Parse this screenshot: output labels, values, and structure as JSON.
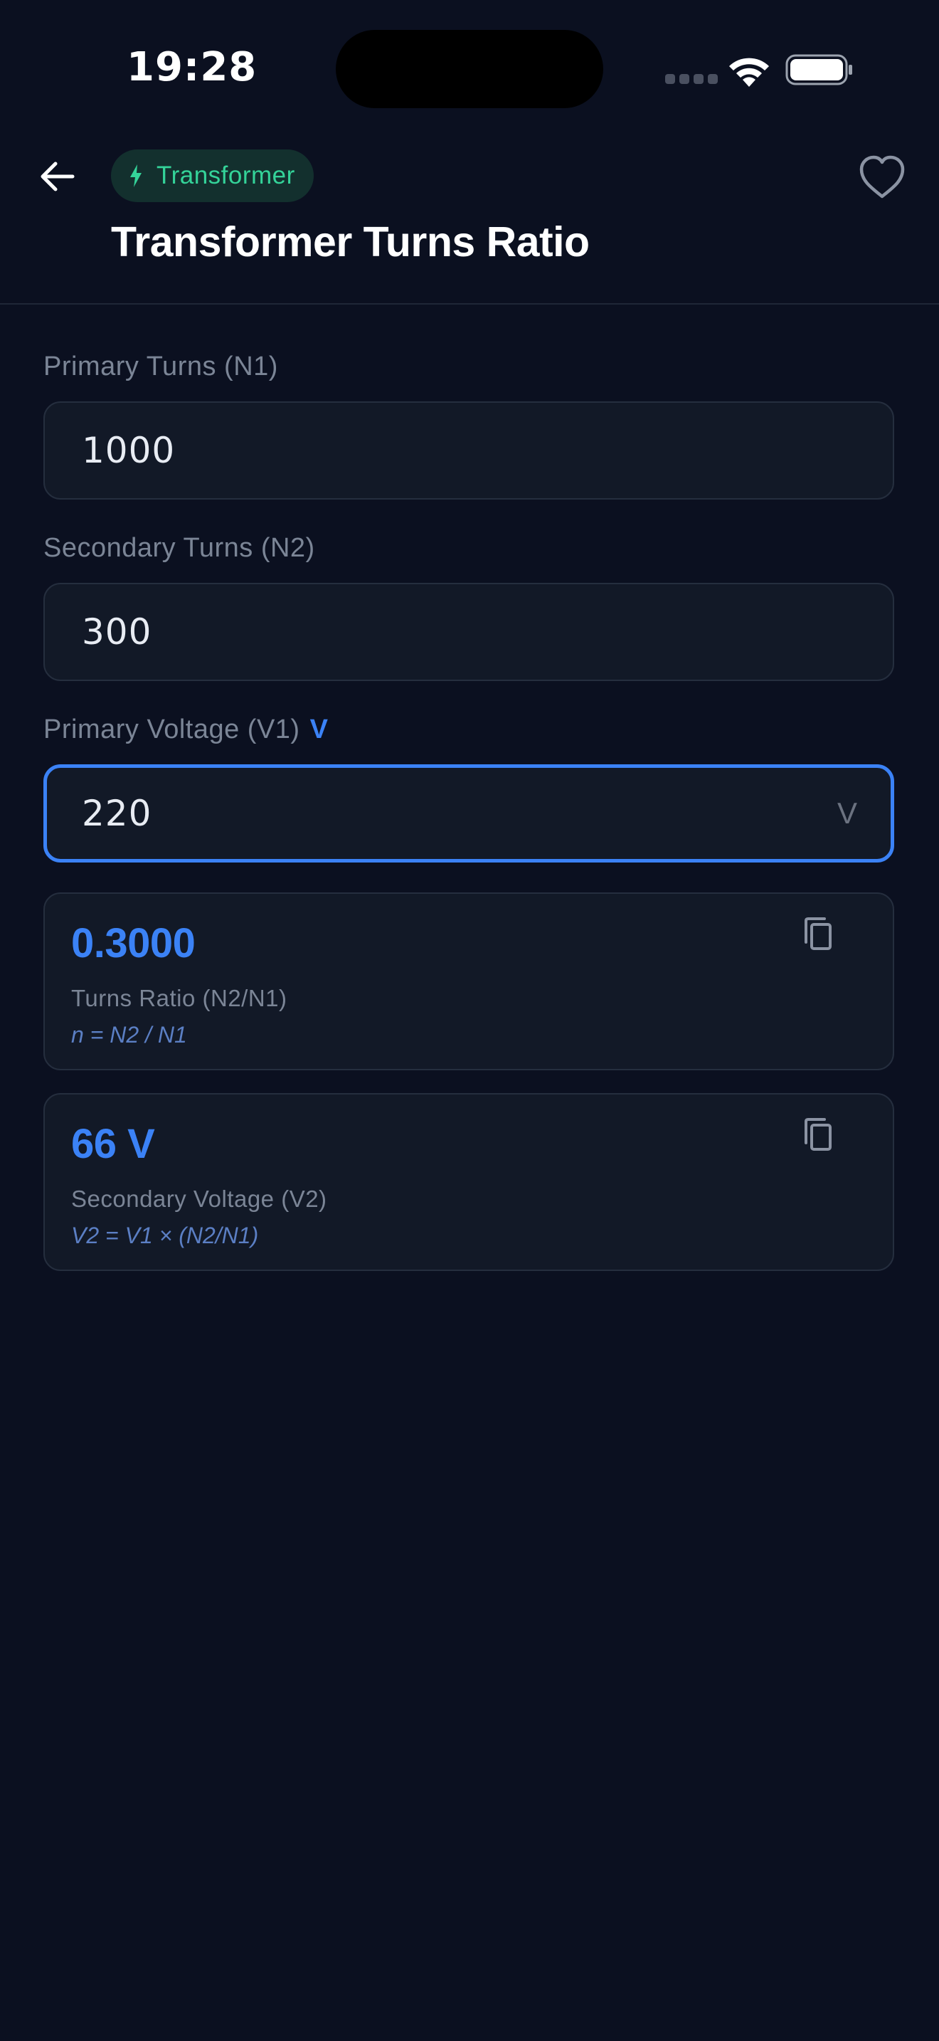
{
  "status_bar": {
    "time": "19:28"
  },
  "header": {
    "category_tag": "Transformer",
    "category_icon": "bolt-icon",
    "title": "Transformer Turns Ratio"
  },
  "inputs": [
    {
      "label": "Primary Turns (N1)",
      "value": "1000",
      "unit": ""
    },
    {
      "label": "Secondary Turns (N2)",
      "value": "300",
      "unit": ""
    },
    {
      "label": "Primary Voltage (V1)",
      "label_unit": "V",
      "value": "220",
      "unit": "V"
    }
  ],
  "results": [
    {
      "value": "0.3000",
      "label": "Turns Ratio (N2/N1)",
      "formula": "n = N2 / N1"
    },
    {
      "value": "66 V",
      "label": "Secondary Voltage (V2)",
      "formula": "V2 = V1 × (N2/N1)"
    }
  ],
  "colors": {
    "background": "#0b1020",
    "accent": "#3b82f6",
    "tag_text": "#34d399"
  }
}
